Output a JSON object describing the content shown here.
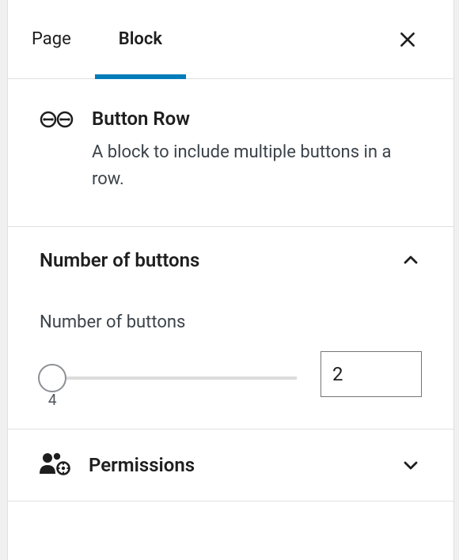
{
  "tabs": {
    "page": "Page",
    "block": "Block"
  },
  "block": {
    "title": "Button Row",
    "description": "A block to include multiple buttons in a row."
  },
  "sections": {
    "numButtons": {
      "title": "Number of buttons",
      "fieldLabel": "Number of buttons",
      "value": "2",
      "tick": "4"
    },
    "permissions": {
      "title": "Permissions"
    }
  }
}
